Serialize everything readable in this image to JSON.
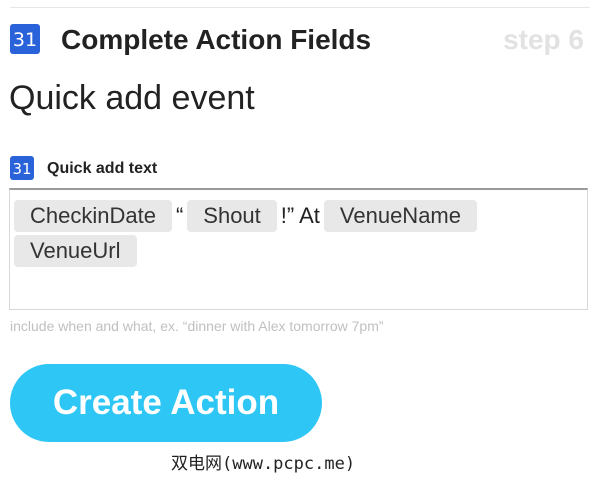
{
  "header": {
    "icon_number": "31",
    "title": "Complete Action Fields",
    "step": "step 6"
  },
  "section_title": "Quick add event",
  "field": {
    "icon_number": "31",
    "label": "Quick add text",
    "tokens": {
      "checkin_date": "CheckinDate",
      "open_quote": "“",
      "shout": "Shout",
      "close_quote_at": "!” At",
      "venue_name": "VenueName",
      "venue_url": "VenueUrl"
    },
    "helper": "include when and what, ex. “dinner with Alex tomorrow 7pm”"
  },
  "create_button_label": "Create Action",
  "watermark": "双电网(www.pcpc.me)",
  "colors": {
    "icon_blue": "#2a62d9",
    "button_cyan": "#2ec7f5",
    "pill_gray": "#e8e8e8",
    "step_gray": "#e2e2e2",
    "helper_gray": "#c0c0c0"
  }
}
